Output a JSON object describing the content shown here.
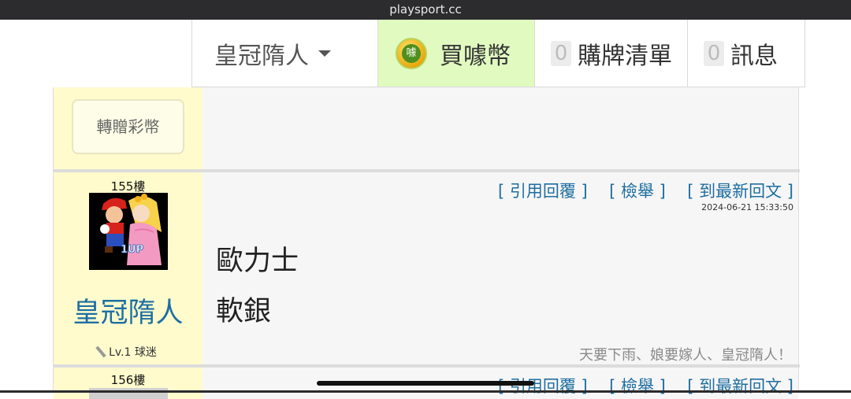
{
  "browser": {
    "url": "playsport.cc"
  },
  "nav": {
    "user_label": "皇冠隋人",
    "coin_icon_text": "噱",
    "buy_label": "買噱幣",
    "cart_count": "0",
    "cart_label": "購牌清單",
    "msg_count": "0",
    "msg_label": "訊息"
  },
  "post_prev": {
    "gift_button": "轉贈彩幣"
  },
  "post_155": {
    "floor": "155樓",
    "username": "皇冠隋人",
    "level": "Lv.1 球迷",
    "action_quote": "引用回覆",
    "action_report": "檢舉",
    "action_latest": "到最新回文",
    "timestamp": "2024-06-21 15:33:50",
    "content": [
      "歐力士",
      "軟銀"
    ],
    "signature": "天要下雨、娘要嫁人、皇冠隋人！",
    "avatar_badge": "1UP"
  },
  "post_156": {
    "floor": "156樓",
    "action_quote": "引用回覆",
    "action_report": "檢舉",
    "action_latest": "到最新回文"
  },
  "colors": {
    "accent_link": "#1f6ea0",
    "buy_bg": "#e1fac0",
    "user_col_bg": "#fffbcd"
  }
}
